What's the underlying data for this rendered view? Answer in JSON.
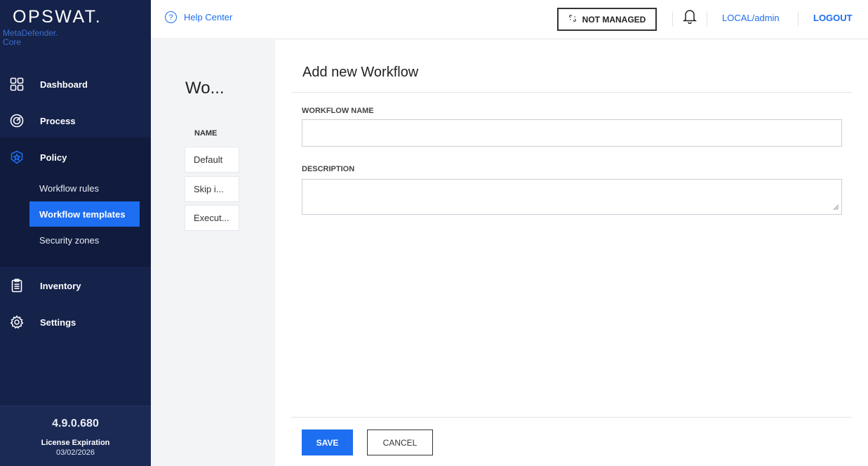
{
  "brand": {
    "logo": "OPSWAT.",
    "product_line1": "MetaDefender.",
    "product_line2": "Core"
  },
  "nav": {
    "dashboard": "Dashboard",
    "process": "Process",
    "policy": "Policy",
    "policy_sub": [
      "Workflow rules",
      "Workflow templates",
      "Security zones"
    ],
    "inventory": "Inventory",
    "settings": "Settings"
  },
  "footer": {
    "version": "4.9.0.680",
    "license_label": "License Expiration",
    "license_date": "03/02/2026"
  },
  "topbar": {
    "help": "Help Center",
    "help_icon_glyph": "?",
    "not_managed": "NOT MANAGED",
    "user": "LOCAL/admin",
    "logout": "LOGOUT"
  },
  "list": {
    "title": "Wo...",
    "column_header": "NAME",
    "rows": [
      "Default",
      "Skip i...",
      "Execut..."
    ]
  },
  "panel": {
    "title": "Add new Workflow",
    "workflow_name_label": "WORKFLOW NAME",
    "workflow_name_value": "",
    "description_label": "DESCRIPTION",
    "description_value": "",
    "save_label": "SAVE",
    "cancel_label": "CANCEL"
  },
  "colors": {
    "sidebar_bg": "#15224a",
    "accent": "#1d6ef0"
  }
}
